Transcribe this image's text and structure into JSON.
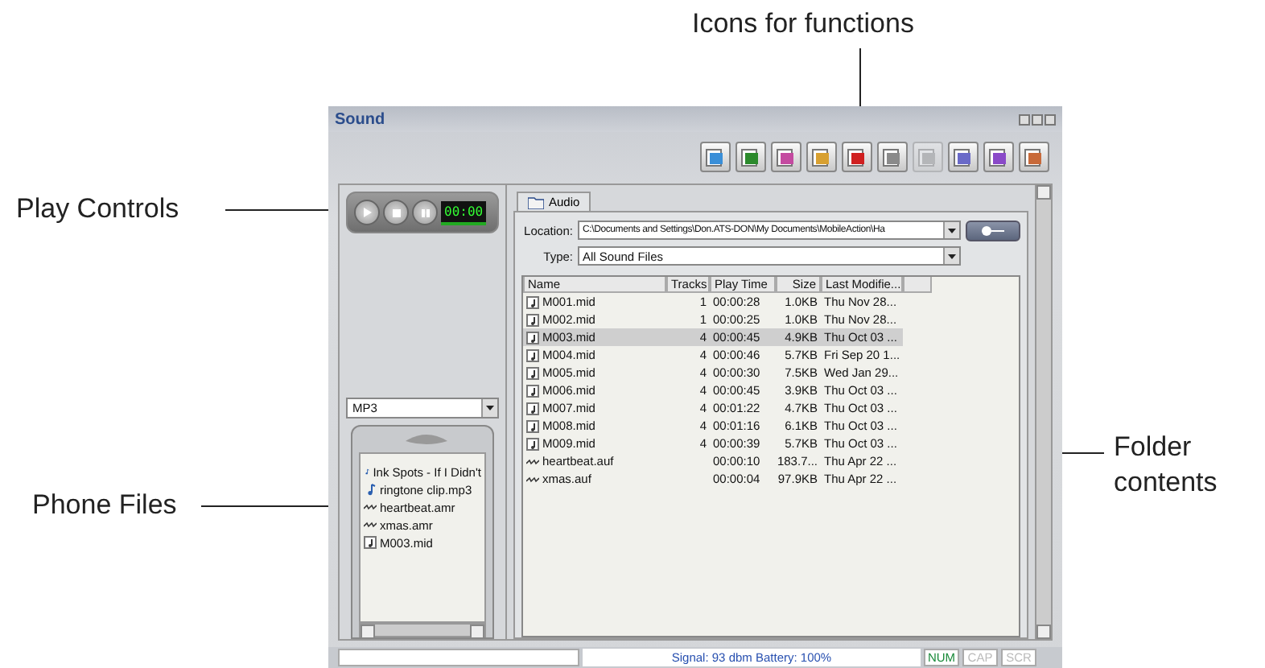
{
  "callouts": {
    "top": "Icons for functions",
    "play": "Play Controls",
    "phone": "Phone Files",
    "folder": [
      "Folder",
      "contents"
    ]
  },
  "window": {
    "title": "Sound"
  },
  "toolbar": [
    {
      "disabled": false
    },
    {
      "disabled": false
    },
    {
      "disabled": false
    },
    {
      "disabled": false
    },
    {
      "disabled": false
    },
    {
      "disabled": false
    },
    {
      "disabled": true
    },
    {
      "disabled": false
    },
    {
      "disabled": false
    },
    {
      "disabled": false
    }
  ],
  "player": {
    "time": "00:00"
  },
  "phone": {
    "format": "MP3",
    "files": [
      {
        "name": "Ink Spots - If I Didn't",
        "kind": "note"
      },
      {
        "name": "ringtone clip.mp3",
        "kind": "note"
      },
      {
        "name": "heartbeat.amr",
        "kind": "wave"
      },
      {
        "name": "xmas.amr",
        "kind": "wave"
      },
      {
        "name": "M003.mid",
        "kind": "midi"
      }
    ]
  },
  "tabs": [
    {
      "label": "Audio",
      "selected": true
    }
  ],
  "location": {
    "label": "Location:",
    "value": "C:\\Documents and Settings\\Don.ATS-DON\\My Documents\\MobileAction\\Ha"
  },
  "type": {
    "label": "Type:",
    "value": "All Sound Files"
  },
  "table": {
    "columns": [
      "Name",
      "Tracks",
      "Play Time",
      "Size",
      "Last Modifie..."
    ],
    "rows": [
      {
        "kind": "midi",
        "selected": false,
        "cells": [
          "M001.mid",
          "1",
          "00:00:28",
          "1.0KB",
          "Thu Nov 28..."
        ]
      },
      {
        "kind": "midi",
        "selected": false,
        "cells": [
          "M002.mid",
          "1",
          "00:00:25",
          "1.0KB",
          "Thu Nov 28..."
        ]
      },
      {
        "kind": "midi",
        "selected": true,
        "cells": [
          "M003.mid",
          "4",
          "00:00:45",
          "4.9KB",
          "Thu Oct 03 ..."
        ]
      },
      {
        "kind": "midi",
        "selected": false,
        "cells": [
          "M004.mid",
          "4",
          "00:00:46",
          "5.7KB",
          "Fri Sep 20 1..."
        ]
      },
      {
        "kind": "midi",
        "selected": false,
        "cells": [
          "M005.mid",
          "4",
          "00:00:30",
          "7.5KB",
          "Wed Jan 29..."
        ]
      },
      {
        "kind": "midi",
        "selected": false,
        "cells": [
          "M006.mid",
          "4",
          "00:00:45",
          "3.9KB",
          "Thu Oct 03 ..."
        ]
      },
      {
        "kind": "midi",
        "selected": false,
        "cells": [
          "M007.mid",
          "4",
          "00:01:22",
          "4.7KB",
          "Thu Oct 03 ..."
        ]
      },
      {
        "kind": "midi",
        "selected": false,
        "cells": [
          "M008.mid",
          "4",
          "00:01:16",
          "6.1KB",
          "Thu Oct 03 ..."
        ]
      },
      {
        "kind": "midi",
        "selected": false,
        "cells": [
          "M009.mid",
          "4",
          "00:00:39",
          "5.7KB",
          "Thu Oct 03 ..."
        ]
      },
      {
        "kind": "wave",
        "selected": false,
        "cells": [
          "heartbeat.auf",
          "",
          "00:00:10",
          "183.7...",
          "Thu Apr 22 ..."
        ]
      },
      {
        "kind": "wave",
        "selected": false,
        "cells": [
          "xmas.auf",
          "",
          "00:00:04",
          "97.9KB",
          "Thu Apr 22 ..."
        ]
      }
    ]
  },
  "status_bar": {
    "text": "Signal: 93 dbm Battery: 100%",
    "indicators": [
      {
        "label": "NUM",
        "on": true
      },
      {
        "label": "CAP",
        "on": false
      },
      {
        "label": "SCR",
        "on": false
      }
    ]
  }
}
